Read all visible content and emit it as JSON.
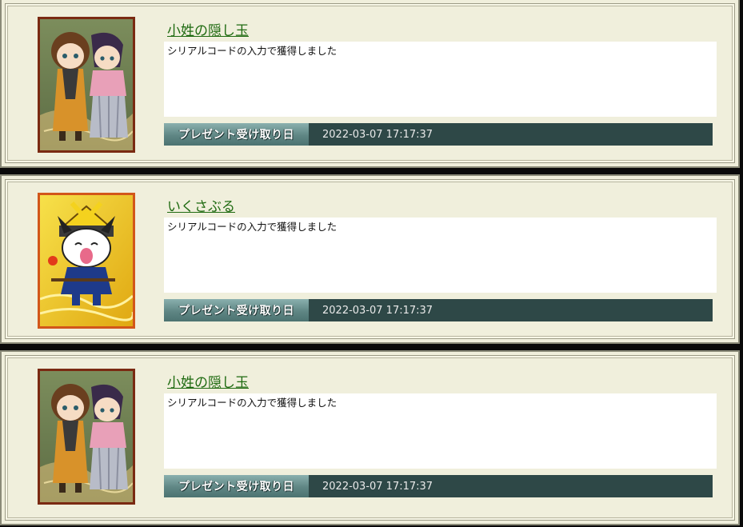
{
  "received_label": "プレゼント受け取り日",
  "items": [
    {
      "title": "小姓の隠し玉",
      "message": "シリアルコードの入力で獲得しました",
      "received_date": "2022-03-07 17:17:37",
      "image": "two-chibi-characters-card"
    },
    {
      "title": "いくさぶる",
      "message": "シリアルコードの入力で獲得しました",
      "received_date": "2022-03-07 17:17:37",
      "image": "samurai-dog-mascot-card"
    },
    {
      "title": "小姓の隠し玉",
      "message": "シリアルコードの入力で獲得しました",
      "received_date": "2022-03-07 17:17:37",
      "image": "two-chibi-characters-card"
    }
  ],
  "colors": {
    "card_background": "#f0efdc",
    "title_link": "#1e6a10",
    "date_bar": "#2e4847",
    "thumb_border": "#7a2a12"
  }
}
